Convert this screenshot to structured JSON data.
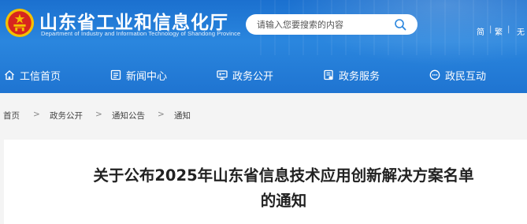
{
  "header": {
    "site_title": "山东省工业和信息化厅",
    "site_subtitle": "Department of Industry and Information Technology of Shandong Province",
    "search": {
      "placeholder": "请输入您要搜索的内容"
    },
    "lang": {
      "simplified": "简",
      "traditional": "繁",
      "accessibility": "无"
    }
  },
  "nav": {
    "items": [
      {
        "label": "工信首页",
        "icon": "home-icon"
      },
      {
        "label": "新闻中心",
        "icon": "news-icon"
      },
      {
        "label": "政务公开",
        "icon": "monitor-icon"
      },
      {
        "label": "政务服务",
        "icon": "service-icon"
      },
      {
        "label": "政民互动",
        "icon": "interaction-icon"
      }
    ]
  },
  "breadcrumb": {
    "items": [
      "首页",
      "政务公开",
      "通知公告",
      "通知"
    ],
    "separator": ">"
  },
  "article": {
    "title_line1": "关于公布2025年山东省信息技术应用创新解决方案名单",
    "title_line2": "的通知"
  },
  "colors": {
    "header_blue": "#1f74d1",
    "emblem_red": "#d7261e",
    "emblem_gold": "#f4c000"
  }
}
